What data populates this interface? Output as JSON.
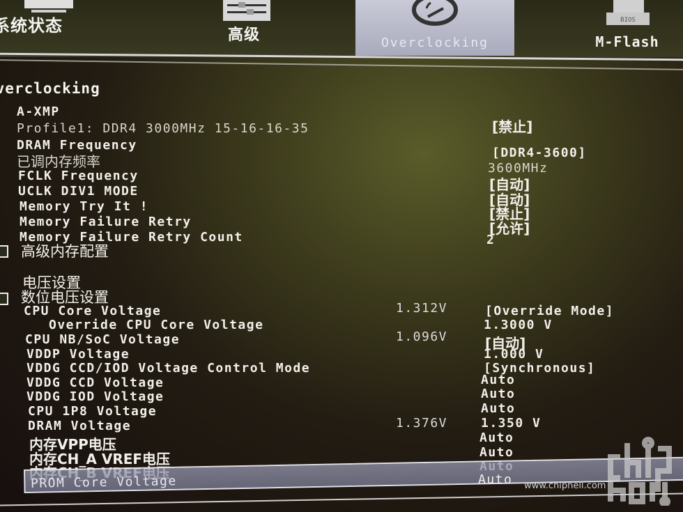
{
  "header": {
    "tabs": [
      {
        "label": "系统状态",
        "icon": "monitor-icon",
        "active": false
      },
      {
        "label": "高级",
        "icon": "sliders-icon",
        "active": false
      },
      {
        "label": "Overclocking",
        "icon": "speedometer-icon",
        "active": true
      },
      {
        "label": "M-Flash",
        "icon": "bios-chip-icon",
        "active": false
      }
    ],
    "bios_chip_text": "BIOS"
  },
  "section_title": "Overclocking",
  "memory": {
    "rows": [
      {
        "label": "A-XMP",
        "value": "[禁止]"
      },
      {
        "label": "Profile1: DDR4 3000MHz 15-16-16-35",
        "value": ""
      },
      {
        "label": "DRAM Frequency",
        "value": "[DDR4-3600]"
      },
      {
        "label": "已调内存频率",
        "value": "3600MHz"
      },
      {
        "label": "FCLK Frequency",
        "value": "[自动]"
      },
      {
        "label": "UCLK DIV1 MODE",
        "value": "[自动]"
      },
      {
        "label": "Memory Try It !",
        "value": "[禁止]"
      },
      {
        "label": "Memory Failure Retry",
        "value": "[允许]"
      },
      {
        "label": "Memory Failure Retry Count",
        "value": "2"
      }
    ],
    "advanced_memory_config": "高级内存配置"
  },
  "voltage": {
    "heading": "电压设置",
    "digital_voltage": "数位电压设置",
    "rows": [
      {
        "label": "CPU Core Voltage",
        "current": "1.312V",
        "value": "[Override Mode]"
      },
      {
        "label": "Override CPU Core Voltage",
        "current": "",
        "value": "1.3000 V"
      },
      {
        "label": "CPU NB/SoC Voltage",
        "current": "1.096V",
        "value": "[自动]"
      },
      {
        "label": "VDDP Voltage",
        "current": "",
        "value": "1.000 V"
      },
      {
        "label": "VDDG CCD/IOD Voltage Control Mode",
        "current": "",
        "value": "[Synchronous]"
      },
      {
        "label": "VDDG CCD Voltage",
        "current": "",
        "value": "Auto"
      },
      {
        "label": "VDDG IOD Voltage",
        "current": "",
        "value": "Auto"
      },
      {
        "label": "CPU 1P8 Voltage",
        "current": "",
        "value": "Auto"
      },
      {
        "label": "DRAM Voltage",
        "current": "1.376V",
        "value": "1.350 V"
      },
      {
        "label": "内存VPP电压",
        "current": "",
        "value": "Auto"
      },
      {
        "label": "内存CH_A VREF电压",
        "current": "",
        "value": "Auto"
      },
      {
        "label": "内存CH_B VREF电压",
        "current": "",
        "value": "Auto"
      },
      {
        "label": "PROM Core Voltage",
        "current": "",
        "value": "Auto",
        "selected": true
      }
    ]
  },
  "watermark": {
    "text": "www.chiphell.com",
    "logo": "chiphell-logo"
  }
}
